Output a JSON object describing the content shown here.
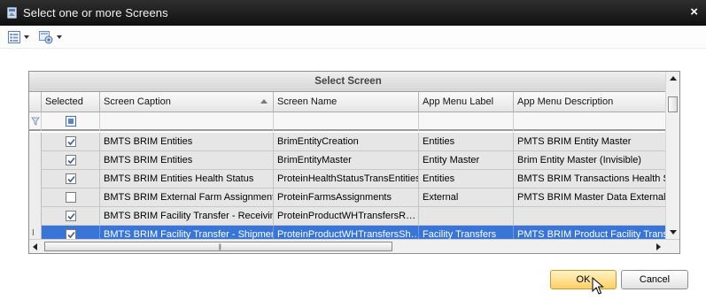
{
  "window": {
    "title": "Select one or more Screens",
    "close_glyph": "×"
  },
  "toolbar": {
    "items": [
      {
        "icon": "list-view-icon"
      },
      {
        "icon": "screen-options-icon"
      }
    ]
  },
  "grid": {
    "group_header": "Select Screen",
    "columns": [
      {
        "label": "Selected"
      },
      {
        "label": "Screen Caption",
        "sorted": "ascending"
      },
      {
        "label": "Screen Name"
      },
      {
        "label": "App Menu Label"
      },
      {
        "label": "App Menu Description"
      }
    ],
    "rows": [
      {
        "selected": true,
        "caption": "BMTS BRIM Entities",
        "name": "BrimEntityCreation",
        "menu_label": "Entities",
        "menu_desc": "PMTS BRIM Entity Master",
        "highlighted": false
      },
      {
        "selected": true,
        "caption": "BMTS BRIM Entities",
        "name": "BrimEntityMaster",
        "menu_label": "Entity Master",
        "menu_desc": "Brim Entity Master (Invisible)",
        "highlighted": false
      },
      {
        "selected": true,
        "caption": "BMTS BRIM Entities Health Status",
        "name": "ProteinHealthStatusTransEntities",
        "menu_label": "Entities",
        "menu_desc": "BMTS BRIM Transactions Health Sta",
        "highlighted": false
      },
      {
        "selected": false,
        "caption": "BMTS BRIM External Farm Assignments",
        "name": "ProteinFarmsAssignments",
        "menu_label": "External",
        "menu_desc": "PMTS BRIM Master Data External Fa",
        "highlighted": false
      },
      {
        "selected": true,
        "caption": "BMTS BRIM Facility Transfer - Receiving",
        "name": "ProteinProductWHTransfersR…",
        "menu_label": "",
        "menu_desc": "",
        "highlighted": false
      },
      {
        "selected": true,
        "caption": "BMTS BRIM Facility Transfer - Shipment",
        "name": "ProteinProductWHTransfersSh…",
        "menu_label": "Facility Transfers",
        "menu_desc": "PMTS BRIM Product Facility Transfe",
        "highlighted": true
      }
    ]
  },
  "buttons": {
    "ok_label": "OK",
    "cancel_label": "Cancel"
  },
  "colors": {
    "title_bar": "#1a1a1a",
    "row_background": "#e6e6e6",
    "highlight": "#3875d7",
    "ok_button": "#fdd065"
  }
}
